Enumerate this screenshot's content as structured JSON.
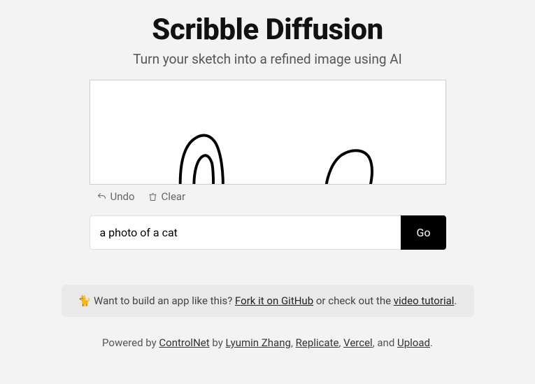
{
  "header": {
    "title": "Scribble Diffusion",
    "subtitle": "Turn your sketch into a refined image using AI"
  },
  "toolbar": {
    "undo_label": "Undo",
    "clear_label": "Clear"
  },
  "prompt": {
    "value": "a photo of a cat",
    "go_label": "Go"
  },
  "cta": {
    "prefix": "🐈 Want to build an app like this? ",
    "fork_label": "Fork it on GitHub",
    "middle": " or check out the ",
    "tutorial_label": "video tutorial",
    "suffix": "."
  },
  "footer": {
    "prefix": "Powered by ",
    "controlnet": "ControlNet",
    "by": " by ",
    "lyumin": "Lyumin Zhang",
    "sep1": ", ",
    "replicate": "Replicate",
    "sep2": ", ",
    "vercel": "Vercel",
    "sep3": ", and ",
    "upload": "Upload",
    "suffix": "."
  }
}
